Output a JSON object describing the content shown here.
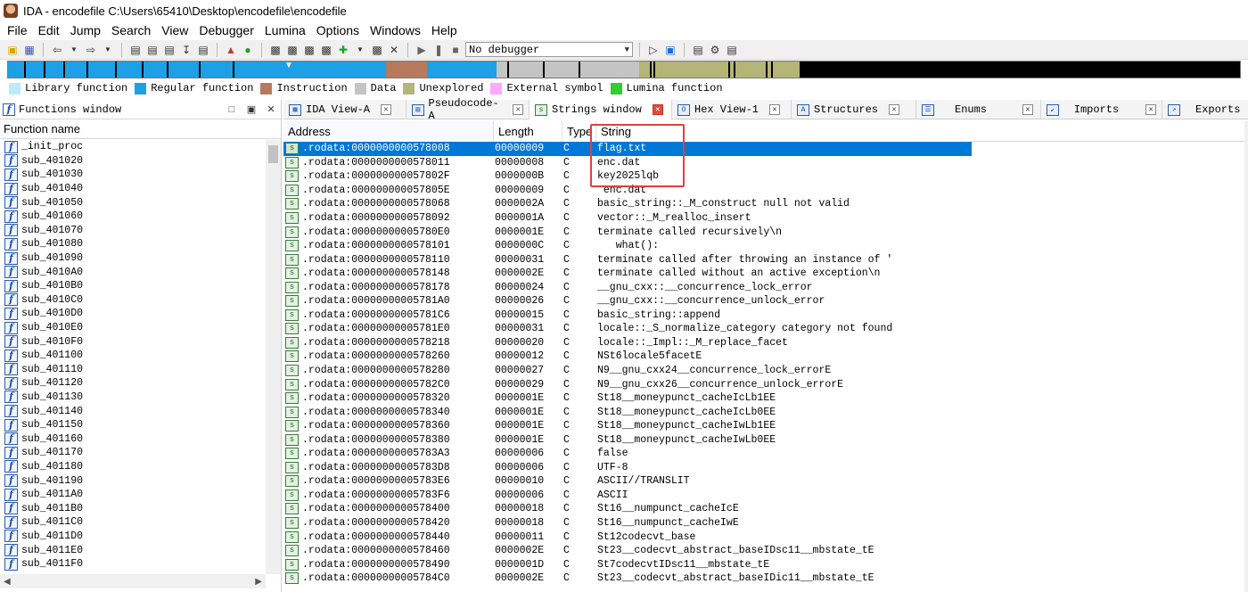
{
  "window": {
    "title": "IDA - encodefile C:\\Users\\65410\\Desktop\\encodefile\\encodefile"
  },
  "menu": [
    "File",
    "Edit",
    "Jump",
    "Search",
    "View",
    "Debugger",
    "Lumina",
    "Options",
    "Windows",
    "Help"
  ],
  "toolbar": {
    "debugger_select": "No debugger"
  },
  "legend": [
    {
      "label": "Library function",
      "color": "#b7ecff"
    },
    {
      "label": "Regular function",
      "color": "#1ea0e6"
    },
    {
      "label": "Instruction",
      "color": "#b87a5c"
    },
    {
      "label": "Data",
      "color": "#c4c4c4"
    },
    {
      "label": "Unexplored",
      "color": "#b5b577"
    },
    {
      "label": "External symbol",
      "color": "#ffa8ff"
    },
    {
      "label": "Lumina function",
      "color": "#2fcf2f"
    }
  ],
  "functions_window": {
    "title": "Functions window",
    "column_header": "Function name",
    "functions": [
      "_init_proc",
      "sub_401020",
      "sub_401030",
      "sub_401040",
      "sub_401050",
      "sub_401060",
      "sub_401070",
      "sub_401080",
      "sub_401090",
      "sub_4010A0",
      "sub_4010B0",
      "sub_4010C0",
      "sub_4010D0",
      "sub_4010E0",
      "sub_4010F0",
      "sub_401100",
      "sub_401110",
      "sub_401120",
      "sub_401130",
      "sub_401140",
      "sub_401150",
      "sub_401160",
      "sub_401170",
      "sub_401180",
      "sub_401190",
      "sub_4011A0",
      "sub_4011B0",
      "sub_4011C0",
      "sub_4011D0",
      "sub_4011E0",
      "sub_4011F0"
    ]
  },
  "tabs": [
    {
      "label": "IDA View-A",
      "icon": "ida-view-icon",
      "active": false
    },
    {
      "label": "Pseudocode-A",
      "icon": "pseudocode-icon",
      "active": false
    },
    {
      "label": "Strings window",
      "icon": "strings-icon",
      "active": true
    },
    {
      "label": "Hex View-1",
      "icon": "hex-view-icon",
      "active": false
    },
    {
      "label": "Structures",
      "icon": "structures-icon",
      "active": false
    },
    {
      "label": "Enums",
      "icon": "enums-icon",
      "active": false
    },
    {
      "label": "Imports",
      "icon": "imports-icon",
      "active": false
    },
    {
      "label": "Exports",
      "icon": "exports-icon",
      "active": false
    }
  ],
  "strings_window": {
    "columns": [
      "Address",
      "Length",
      "Type",
      "String"
    ],
    "rows": [
      {
        "address": ".rodata:0000000000578008",
        "length": "00000009",
        "type": "C",
        "string": "flag.txt",
        "selected": true
      },
      {
        "address": ".rodata:0000000000578011",
        "length": "00000008",
        "type": "C",
        "string": "enc.dat"
      },
      {
        "address": ".rodata:000000000057802F",
        "length": "0000000B",
        "type": "C",
        "string": "key2025lqb"
      },
      {
        "address": ".rodata:000000000057805E",
        "length": "00000009",
        "type": "C",
        "string": " enc.dat"
      },
      {
        "address": ".rodata:0000000000578068",
        "length": "0000002A",
        "type": "C",
        "string": "basic_string::_M_construct null not valid"
      },
      {
        "address": ".rodata:0000000000578092",
        "length": "0000001A",
        "type": "C",
        "string": "vector::_M_realloc_insert"
      },
      {
        "address": ".rodata:00000000005780E0",
        "length": "0000001E",
        "type": "C",
        "string": "terminate called recursively\\n"
      },
      {
        "address": ".rodata:0000000000578101",
        "length": "0000000C",
        "type": "C",
        "string": "   what():"
      },
      {
        "address": ".rodata:0000000000578110",
        "length": "00000031",
        "type": "C",
        "string": "terminate called after throwing an instance of '"
      },
      {
        "address": ".rodata:0000000000578148",
        "length": "0000002E",
        "type": "C",
        "string": "terminate called without an active exception\\n"
      },
      {
        "address": ".rodata:0000000000578178",
        "length": "00000024",
        "type": "C",
        "string": "__gnu_cxx::__concurrence_lock_error"
      },
      {
        "address": ".rodata:00000000005781A0",
        "length": "00000026",
        "type": "C",
        "string": "__gnu_cxx::__concurrence_unlock_error"
      },
      {
        "address": ".rodata:00000000005781C6",
        "length": "00000015",
        "type": "C",
        "string": "basic_string::append"
      },
      {
        "address": ".rodata:00000000005781E0",
        "length": "00000031",
        "type": "C",
        "string": "locale::_S_normalize_category category not found"
      },
      {
        "address": ".rodata:0000000000578218",
        "length": "00000020",
        "type": "C",
        "string": "locale::_Impl::_M_replace_facet"
      },
      {
        "address": ".rodata:0000000000578260",
        "length": "00000012",
        "type": "C",
        "string": "NSt6locale5facetE"
      },
      {
        "address": ".rodata:0000000000578280",
        "length": "00000027",
        "type": "C",
        "string": "N9__gnu_cxx24__concurrence_lock_errorE"
      },
      {
        "address": ".rodata:00000000005782C0",
        "length": "00000029",
        "type": "C",
        "string": "N9__gnu_cxx26__concurrence_unlock_errorE"
      },
      {
        "address": ".rodata:0000000000578320",
        "length": "0000001E",
        "type": "C",
        "string": "St18__moneypunct_cacheIcLb1EE"
      },
      {
        "address": ".rodata:0000000000578340",
        "length": "0000001E",
        "type": "C",
        "string": "St18__moneypunct_cacheIcLb0EE"
      },
      {
        "address": ".rodata:0000000000578360",
        "length": "0000001E",
        "type": "C",
        "string": "St18__moneypunct_cacheIwLb1EE"
      },
      {
        "address": ".rodata:0000000000578380",
        "length": "0000001E",
        "type": "C",
        "string": "St18__moneypunct_cacheIwLb0EE"
      },
      {
        "address": ".rodata:00000000005783A3",
        "length": "00000006",
        "type": "C",
        "string": "false"
      },
      {
        "address": ".rodata:00000000005783D8",
        "length": "00000006",
        "type": "C",
        "string": "UTF-8"
      },
      {
        "address": ".rodata:00000000005783E6",
        "length": "00000010",
        "type": "C",
        "string": "ASCII//TRANSLIT"
      },
      {
        "address": ".rodata:00000000005783F6",
        "length": "00000006",
        "type": "C",
        "string": "ASCII"
      },
      {
        "address": ".rodata:0000000000578400",
        "length": "00000018",
        "type": "C",
        "string": "St16__numpunct_cacheIcE"
      },
      {
        "address": ".rodata:0000000000578420",
        "length": "00000018",
        "type": "C",
        "string": "St16__numpunct_cacheIwE"
      },
      {
        "address": ".rodata:0000000000578440",
        "length": "00000011",
        "type": "C",
        "string": "St12codecvt_base"
      },
      {
        "address": ".rodata:0000000000578460",
        "length": "0000002E",
        "type": "C",
        "string": "St23__codecvt_abstract_baseIDsc11__mbstate_tE"
      },
      {
        "address": ".rodata:0000000000578490",
        "length": "0000001D",
        "type": "C",
        "string": "St7codecvtIDsc11__mbstate_tE"
      },
      {
        "address": ".rodata:00000000005784C0",
        "length": "0000002E",
        "type": "C",
        "string": "St23__codecvt_abstract_baseIDic11__mbstate_tE"
      }
    ]
  }
}
